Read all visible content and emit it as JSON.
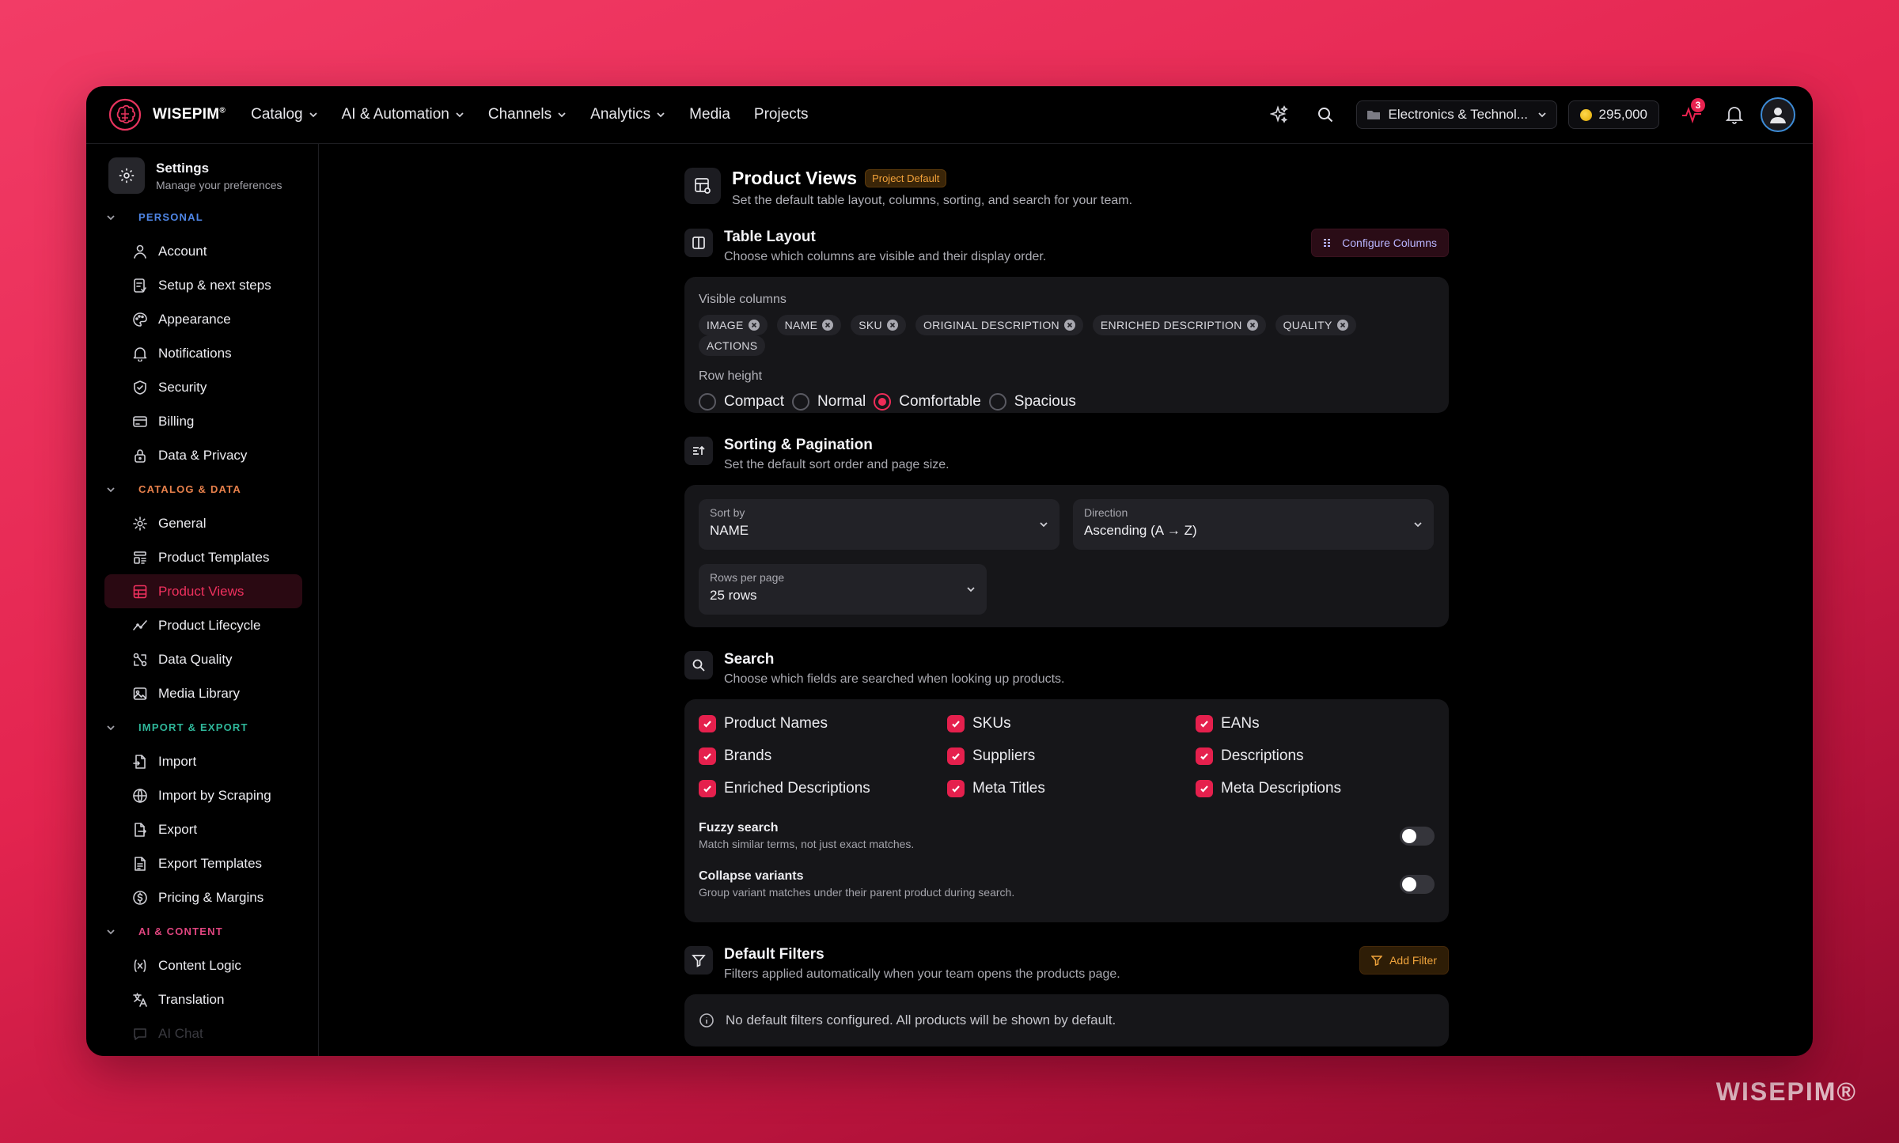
{
  "brand": {
    "name": "WISEPIM",
    "reg": "®"
  },
  "nav": {
    "items": [
      {
        "label": "Catalog",
        "dropdown": true
      },
      {
        "label": "AI & Automation",
        "dropdown": true
      },
      {
        "label": "Channels",
        "dropdown": true
      },
      {
        "label": "Analytics",
        "dropdown": true
      },
      {
        "label": "Media",
        "dropdown": false
      },
      {
        "label": "Projects",
        "dropdown": false
      }
    ],
    "workspace": "Electronics & Technol...",
    "credits": "295,000",
    "activity_badge": "3"
  },
  "sidebar": {
    "title": "Settings",
    "subtitle": "Manage your preferences",
    "sections": [
      {
        "label": "PERSONAL",
        "color": "#4f86e6",
        "items": [
          {
            "label": "Account",
            "icon": "user-icon"
          },
          {
            "label": "Setup & next steps",
            "icon": "checklist-icon"
          },
          {
            "label": "Appearance",
            "icon": "palette-icon"
          },
          {
            "label": "Notifications",
            "icon": "bell-icon"
          },
          {
            "label": "Security",
            "icon": "shield-icon"
          },
          {
            "label": "Billing",
            "icon": "credit-card-icon"
          },
          {
            "label": "Data & Privacy",
            "icon": "lock-icon"
          }
        ]
      },
      {
        "label": "CATALOG & DATA",
        "color": "#e7804b",
        "items": [
          {
            "label": "General",
            "icon": "gear-icon"
          },
          {
            "label": "Product Templates",
            "icon": "template-icon"
          },
          {
            "label": "Product Views",
            "icon": "table-view-icon",
            "active": true
          },
          {
            "label": "Product Lifecycle",
            "icon": "trend-icon"
          },
          {
            "label": "Data Quality",
            "icon": "quality-icon"
          },
          {
            "label": "Media Library",
            "icon": "image-icon"
          }
        ]
      },
      {
        "label": "IMPORT & EXPORT",
        "color": "#2fb79a",
        "items": [
          {
            "label": "Import",
            "icon": "file-import-icon"
          },
          {
            "label": "Import by Scraping",
            "icon": "globe-icon"
          },
          {
            "label": "Export",
            "icon": "file-export-icon"
          },
          {
            "label": "Export Templates",
            "icon": "file-template-icon"
          },
          {
            "label": "Pricing & Margins",
            "icon": "dollar-icon"
          }
        ]
      },
      {
        "label": "AI & CONTENT",
        "color": "#e0457f",
        "items": [
          {
            "label": "Content Logic",
            "icon": "variable-icon"
          },
          {
            "label": "Translation",
            "icon": "translate-icon"
          },
          {
            "label": "AI Chat",
            "icon": "chat-icon",
            "faded": true
          }
        ]
      }
    ]
  },
  "page": {
    "title": "Product Views",
    "badge": "Project Default",
    "subtitle": "Set the default table layout, columns, sorting, and search for your team."
  },
  "table_layout": {
    "title": "Table Layout",
    "subtitle": "Choose which columns are visible and their display order.",
    "button": "Configure Columns",
    "visible_label": "Visible columns",
    "columns": [
      {
        "label": "IMAGE",
        "removable": true
      },
      {
        "label": "NAME",
        "removable": true
      },
      {
        "label": "SKU",
        "removable": true
      },
      {
        "label": "ORIGINAL DESCRIPTION",
        "removable": true
      },
      {
        "label": "ENRICHED DESCRIPTION",
        "removable": true
      },
      {
        "label": "QUALITY",
        "removable": true
      },
      {
        "label": "ACTIONS",
        "removable": false
      }
    ],
    "row_height_label": "Row height",
    "row_heights": [
      {
        "label": "Compact",
        "selected": false
      },
      {
        "label": "Normal",
        "selected": false
      },
      {
        "label": "Comfortable",
        "selected": true
      },
      {
        "label": "Spacious",
        "selected": false
      }
    ]
  },
  "sorting": {
    "title": "Sorting & Pagination",
    "subtitle": "Set the default sort order and page size.",
    "sort_by_label": "Sort by",
    "sort_by_value": "NAME",
    "direction_label": "Direction",
    "direction_value": "Ascending (A → Z)",
    "rows_label": "Rows per page",
    "rows_value": "25 rows"
  },
  "search": {
    "title": "Search",
    "subtitle": "Choose which fields are searched when looking up products.",
    "fields": [
      {
        "label": "Product Names",
        "checked": true
      },
      {
        "label": "SKUs",
        "checked": true
      },
      {
        "label": "EANs",
        "checked": true
      },
      {
        "label": "Brands",
        "checked": true
      },
      {
        "label": "Suppliers",
        "checked": true
      },
      {
        "label": "Descriptions",
        "checked": true
      },
      {
        "label": "Enriched Descriptions",
        "checked": true
      },
      {
        "label": "Meta Titles",
        "checked": true
      },
      {
        "label": "Meta Descriptions",
        "checked": true
      }
    ],
    "fuzzy_title": "Fuzzy search",
    "fuzzy_sub": "Match similar terms, not just exact matches.",
    "fuzzy_on": false,
    "collapse_title": "Collapse variants",
    "collapse_sub": "Group variant matches under their parent product during search.",
    "collapse_on": false
  },
  "filters": {
    "title": "Default Filters",
    "subtitle": "Filters applied automatically when your team opens the products page.",
    "button": "Add Filter",
    "empty": "No default filters configured. All products will be shown by default."
  },
  "watermark": "WISEPIM®"
}
